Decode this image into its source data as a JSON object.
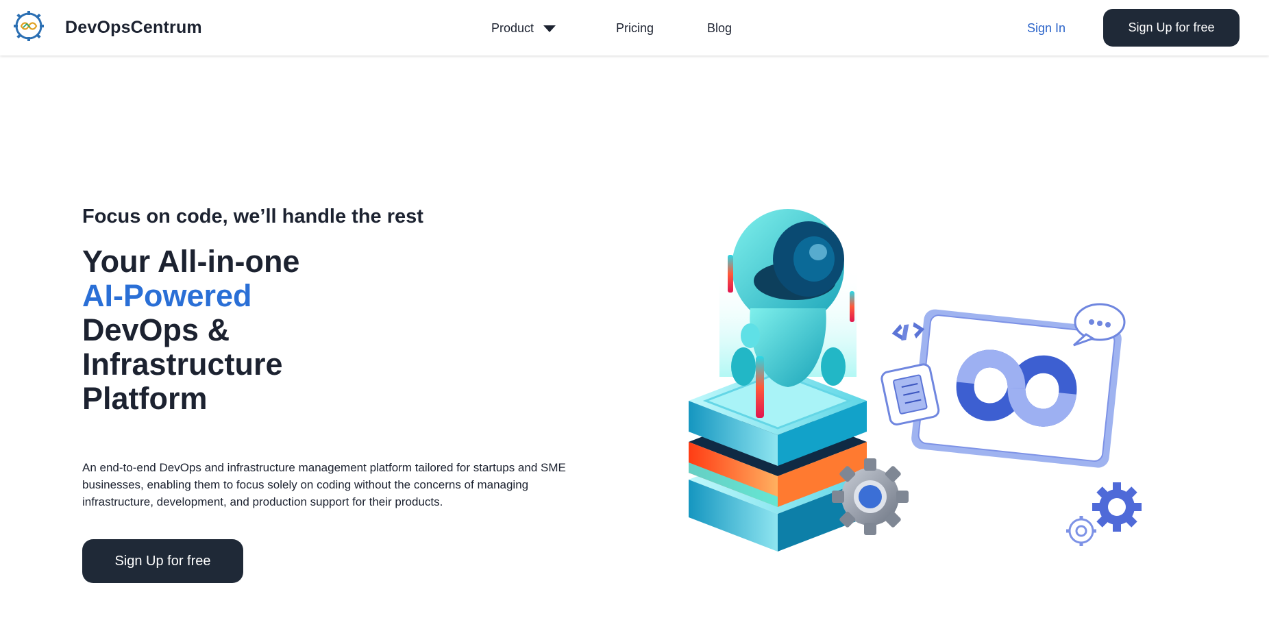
{
  "header": {
    "brand": "DevOpsCentrum",
    "logo_icon": "gear-infinity-logo",
    "nav": [
      {
        "label": "Product",
        "icon": "caret-down-icon"
      },
      {
        "label": "Pricing"
      },
      {
        "label": "Blog"
      }
    ],
    "signin_label": "Sign In",
    "signup_label": "Sign Up for free"
  },
  "hero": {
    "tagline": "Focus on code, we’ll handle the rest",
    "headline": {
      "line1": "Your All-in-one",
      "line2_accent": "AI-Powered",
      "line3": "DevOps &",
      "line4": "Infrastructure",
      "line5": "Platform"
    },
    "description": "An end-to-end DevOps and infrastructure management platform tailored for startups and SME businesses, enabling them to focus solely on coding without the concerns of managing infrastructure, development, and production support for their products.",
    "cta_label": "Sign Up for free",
    "illustration_icon": "robot-server-devops-illustration"
  },
  "colors": {
    "primary_dark": "#1f2937",
    "accent_blue": "#2a6fd6",
    "link_blue": "#2a63c9",
    "text": "#1c2230"
  }
}
